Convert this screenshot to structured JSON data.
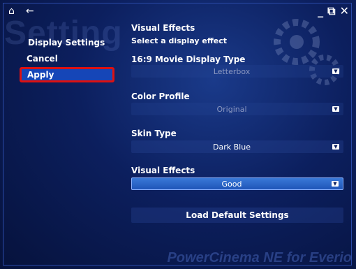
{
  "watermark": "Setting",
  "sidebar": {
    "title": "Display Settings",
    "items": [
      {
        "label": "Cancel"
      },
      {
        "label": "Apply"
      }
    ]
  },
  "window_controls": {
    "minimize": "_",
    "restore": "⧉",
    "close": "✕"
  },
  "panel": {
    "heading": "Visual Effects",
    "subheading": "Select a display effect",
    "settings": [
      {
        "label": "16:9 Movie Display Type",
        "value": "Letterbox"
      },
      {
        "label": "Color Profile",
        "value": "Original"
      },
      {
        "label": "Skin Type",
        "value": "Dark Blue"
      },
      {
        "label": "Visual Effects",
        "value": "Good"
      }
    ],
    "load_default_label": "Load Default Settings"
  },
  "brand": "PowerCinema NE for Everio",
  "colors": {
    "highlight_border": "#d11111",
    "accent": "#1546b8"
  }
}
